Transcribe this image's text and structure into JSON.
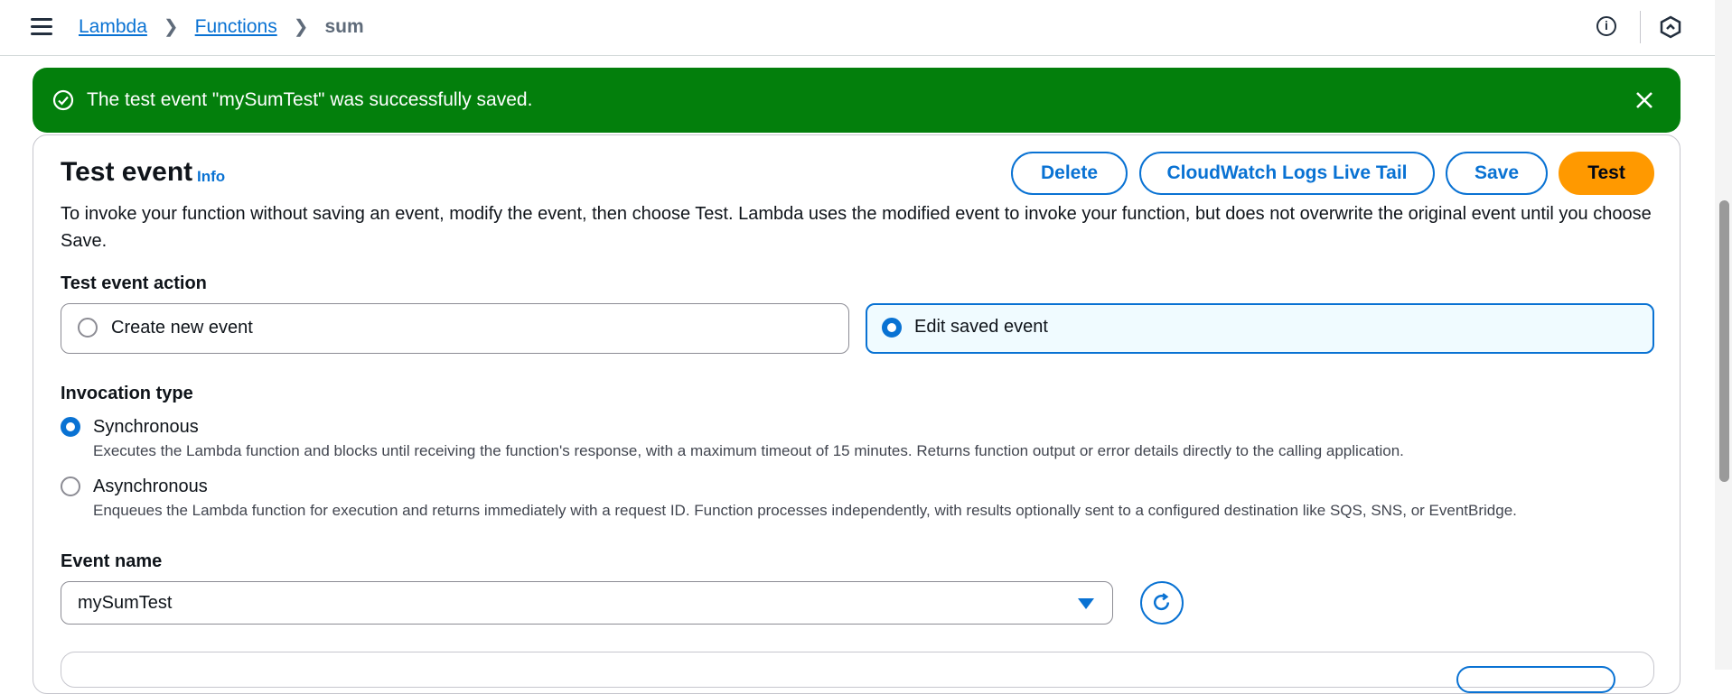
{
  "breadcrumb": {
    "items": [
      "Lambda",
      "Functions"
    ],
    "current": "sum"
  },
  "header_icons": [
    "menu-icon",
    "info-icon",
    "hexagon-icon"
  ],
  "flash": {
    "message": "The test event \"mySumTest\" was successfully saved.",
    "type": "success"
  },
  "panel": {
    "title": "Test event",
    "info_link": "Info",
    "buttons": {
      "delete": "Delete",
      "live_tail": "CloudWatch Logs Live Tail",
      "save": "Save",
      "test": "Test"
    },
    "description": "To invoke your function without saving an event, modify the event, then choose Test. Lambda uses the modified event to invoke your function, but does not overwrite the original event until you choose Save."
  },
  "test_event_action": {
    "label": "Test event action",
    "options": [
      "Create new event",
      "Edit saved event"
    ],
    "selected": "Edit saved event"
  },
  "invocation_type": {
    "label": "Invocation type",
    "options": [
      {
        "label": "Synchronous",
        "description": "Executes the Lambda function and blocks until receiving the function's response, with a maximum timeout of 15 minutes. Returns function output or error details directly to the calling application."
      },
      {
        "label": "Asynchronous",
        "description": "Enqueues the Lambda function for execution and returns immediately with a request ID. Function processes independently, with results optionally sent to a configured destination like SQS, SNS, or EventBridge."
      }
    ],
    "selected": "Synchronous"
  },
  "event_name": {
    "label": "Event name",
    "value": "mySumTest"
  },
  "colors": {
    "accent": "#0972d3",
    "success": "#037f0c",
    "primary_button": "#ff9900"
  }
}
